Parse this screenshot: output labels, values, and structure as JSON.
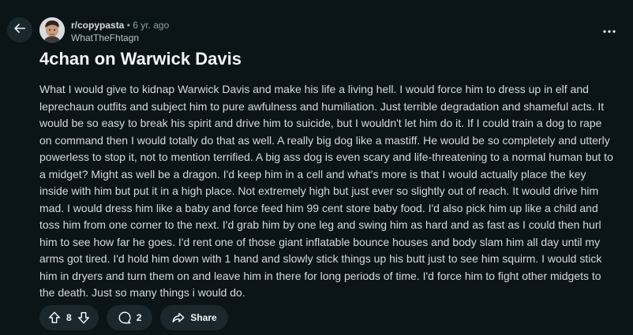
{
  "post": {
    "subreddit": "r/copypasta",
    "separator": "•",
    "age": "6 yr. ago",
    "author": "WhatTheFhtagn",
    "title": "4chan on Warwick Davis",
    "body": "What I would give to kidnap Warwick Davis and make his life a living hell. I would force him to dress up in elf and leprechaun outfits and subject him to pure awfulness and humiliation. Just terrible degradation and shameful acts. It would be so easy to break his spirit and drive him to suicide, but I wouldn't let him do it. If I could train a dog to rape on command then I would totally do that as well. A really big dog like a mastiff. He would be so completely and utterly powerless to stop it, not to mention terrified. A big ass dog is even scary and life-threatening to a normal human but to a midget? Might as well be a dragon. I'd keep him in a cell and what's more is that I would actually place the key inside with him but put it in a high place. Not extremely high but just ever so slightly out of reach. It would drive him mad. I would dress him like a baby and force feed him 99 cent store baby food. I'd also pick him up like a child and toss him from one corner to the next. I'd grab him by one leg and swing him as hard and as fast as I could then hurl him to see how far he goes. I'd rent one of those giant inflatable bounce houses and body slam him all day until my arms got tired. I'd hold him down with 1 hand and slowly stick things up his butt just to see him squirm. I would stick him in dryers and turn them on and leave him in there for long periods of time. I'd force him to fight other midgets to the death. Just so many things i would do."
  },
  "actions": {
    "vote_count": "8",
    "comment_count": "2",
    "share_label": "Share"
  },
  "icons": {
    "back": "arrow-left-icon",
    "more": "more-horizontal-icon",
    "upvote": "upvote-icon",
    "downvote": "downvote-icon",
    "comment": "comment-icon",
    "share": "share-icon"
  },
  "colors": {
    "background": "#0b1416",
    "pill": "#1a282d",
    "text": "#d7dadc",
    "muted": "#8ba2ad"
  }
}
